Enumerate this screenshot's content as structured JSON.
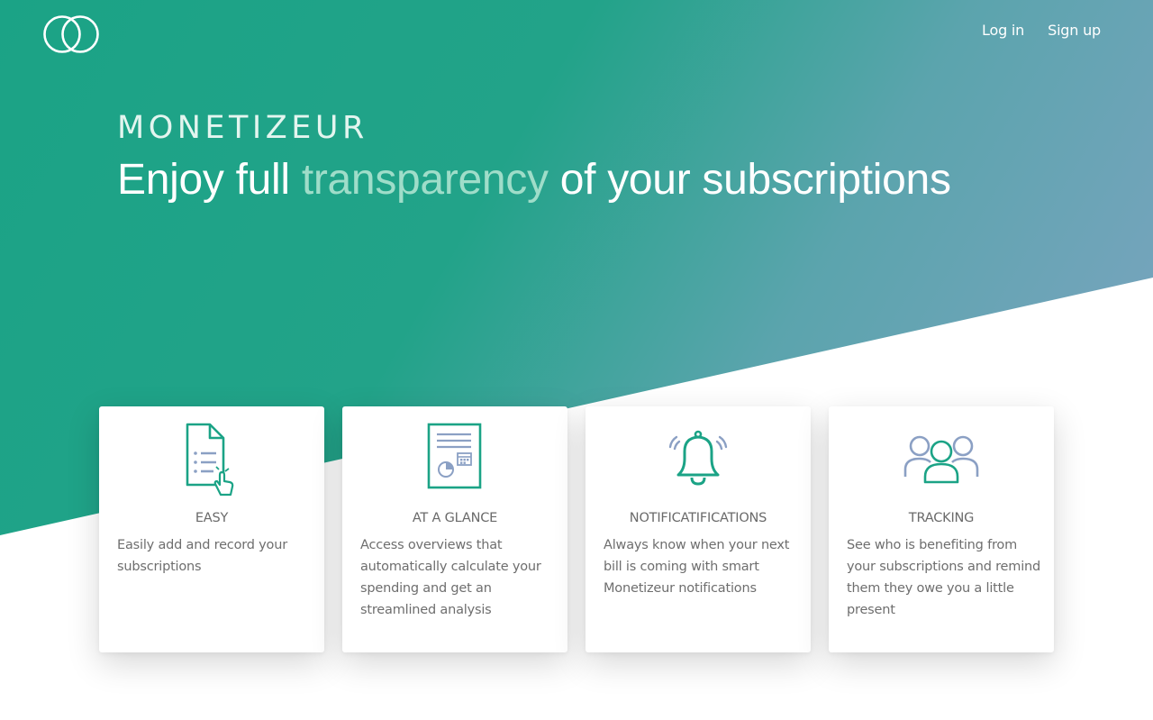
{
  "header": {
    "logo_icon": "interlocking-rings-icon",
    "nav": {
      "login": "Log in",
      "signup": "Sign up"
    }
  },
  "hero": {
    "brand": "MONETIZEUR",
    "headline_before": "Enjoy full ",
    "headline_highlight": "transparency",
    "headline_after": " of your subscriptions"
  },
  "colors": {
    "primary": "#1ba386",
    "highlight": "#9fddc9",
    "icon_blue": "#8ba0c4",
    "icon_green": "#1ba386"
  },
  "features": [
    {
      "icon": "document-list-click-icon",
      "title": "EASY",
      "description": "Easily add and record your subscriptions"
    },
    {
      "icon": "report-chart-icon",
      "title": "AT A GLANCE",
      "description": "Access overviews that automatically calculate your spending and get an streamlined analysis"
    },
    {
      "icon": "bell-ringing-icon",
      "title": "NOTIFICATIFICATIONS",
      "description": "Always know when your next bill is coming with smart Monetizeur notifications"
    },
    {
      "icon": "people-group-icon",
      "title": "TRACKING",
      "description": "See who is benefiting from your subscriptions and remind them they owe you a little present"
    }
  ]
}
